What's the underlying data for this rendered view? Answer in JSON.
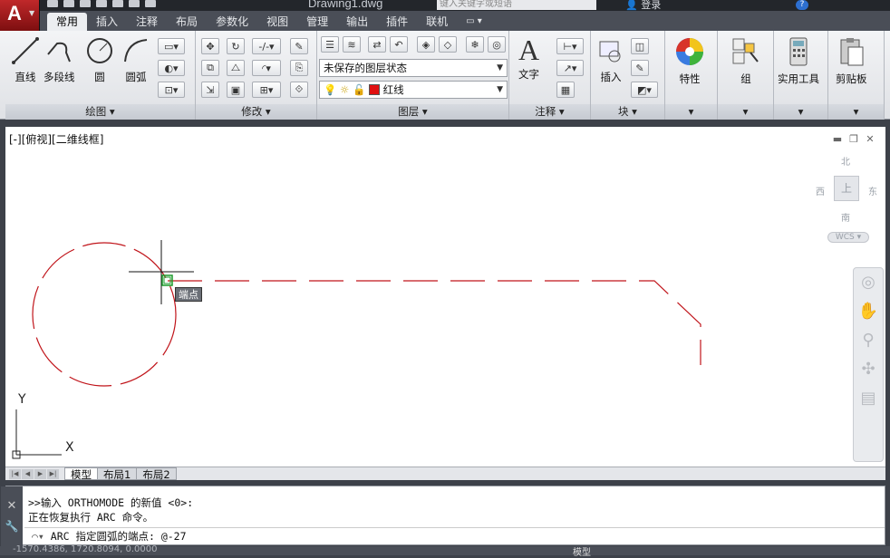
{
  "titlebar": {
    "doc_title": "Drawing1.dwg",
    "search_placeholder": "键入关键字或短语",
    "login_label": "登录",
    "help_label": "?"
  },
  "tabs": [
    "常用",
    "插入",
    "注释",
    "布局",
    "参数化",
    "视图",
    "管理",
    "输出",
    "插件",
    "联机",
    "▭ ▾"
  ],
  "active_tab": "常用",
  "ribbon": {
    "draw": {
      "title": "绘图 ▾",
      "line": "直线",
      "polyline": "多段线",
      "circle": "圆",
      "arc": "圆弧"
    },
    "modify": {
      "title": "修改 ▾"
    },
    "layers": {
      "title": "图层 ▾",
      "state_dropdown": "未保存的图层状态",
      "current_layer": "红线",
      "layer_color": "#e01010"
    },
    "annotation": {
      "title": "注释 ▾",
      "text": "文字"
    },
    "block": {
      "title": "块 ▾",
      "insert": "插入"
    },
    "properties": {
      "label": "特性"
    },
    "group": {
      "label": "组"
    },
    "utilities": {
      "label": "实用工具"
    },
    "clipboard": {
      "label": "剪贴板"
    }
  },
  "viewport": {
    "view_label": "[-][俯视][二维线框]",
    "tooltip": "端点",
    "viewcube": {
      "north": "北",
      "south": "南",
      "east": "东",
      "west": "西",
      "top": "上",
      "wcs": "WCS ▾"
    },
    "ucs_x": "X",
    "ucs_y": "Y",
    "line_color": "#c0141a"
  },
  "layout_tabs": [
    "模型",
    "布局1",
    "布局2"
  ],
  "command": {
    "history": [
      ">>输入 ORTHOMODE 的新值 <0>:",
      "正在恢复执行 ARC 命令。"
    ],
    "prompt": "ARC 指定圆弧的端点: @-27"
  },
  "status": {
    "coords": "-1570.4386, 1720.8094, 0.0000",
    "model_label": "模型"
  }
}
